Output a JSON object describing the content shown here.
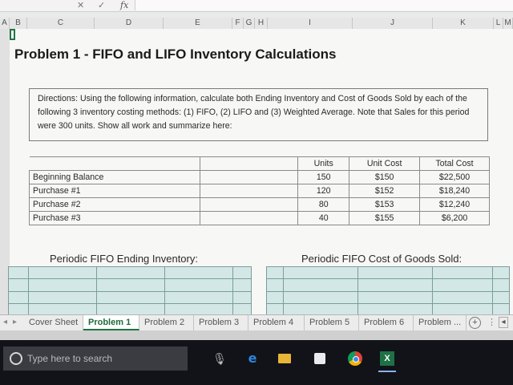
{
  "formula_bar": {
    "cancel": "✕",
    "enter": "✓",
    "fx": "fx"
  },
  "columns": [
    "A",
    "B",
    "C",
    "D",
    "E",
    "F",
    "G",
    "H",
    "I",
    "J",
    "K",
    "L",
    "M"
  ],
  "title": "Problem 1 - FIFO and LIFO Inventory Calculations",
  "directions": "Directions:  Using the following information, calculate both Ending Inventory and Cost of Goods Sold by each of the following 3 inventory costing methods:  (1)  FIFO, (2) LIFO and (3) Weighted Average.  Note that Sales for this period were 300 units.  Show all work and summarize here:",
  "inventory_table": {
    "headers": {
      "units": "Units",
      "unit_cost": "Unit Cost",
      "total_cost": "Total Cost"
    },
    "rows": [
      {
        "label": "Beginning Balance",
        "units": "150",
        "unit_cost": "$150",
        "total_cost": "$22,500"
      },
      {
        "label": "Purchase #1",
        "units": "120",
        "unit_cost": "$152",
        "total_cost": "$18,240"
      },
      {
        "label": "Purchase #2",
        "units": "80",
        "unit_cost": "$153",
        "total_cost": "$12,240"
      },
      {
        "label": "Purchase #3",
        "units": "40",
        "unit_cost": "$155",
        "total_cost": "$6,200"
      }
    ]
  },
  "sections": {
    "fifo_ending": "Periodic FIFO Ending Inventory:",
    "fifo_cogs": "Periodic FIFO Cost of Goods Sold:"
  },
  "colors": {
    "active_tab": "#217346",
    "grid_fill": "#d3e8e6"
  },
  "sheet_tabs": [
    "Cover Sheet",
    "Problem 1",
    "Problem 2",
    "Problem 3",
    "Problem 4",
    "Problem 5",
    "Problem 6",
    "Problem ..."
  ],
  "active_tab_index": 1,
  "add_sheet": "+",
  "tabs_menu": "⋮",
  "tabs_scroll": "◂",
  "taskbar": {
    "search_placeholder": "Type here to search",
    "excel_label": "X"
  }
}
